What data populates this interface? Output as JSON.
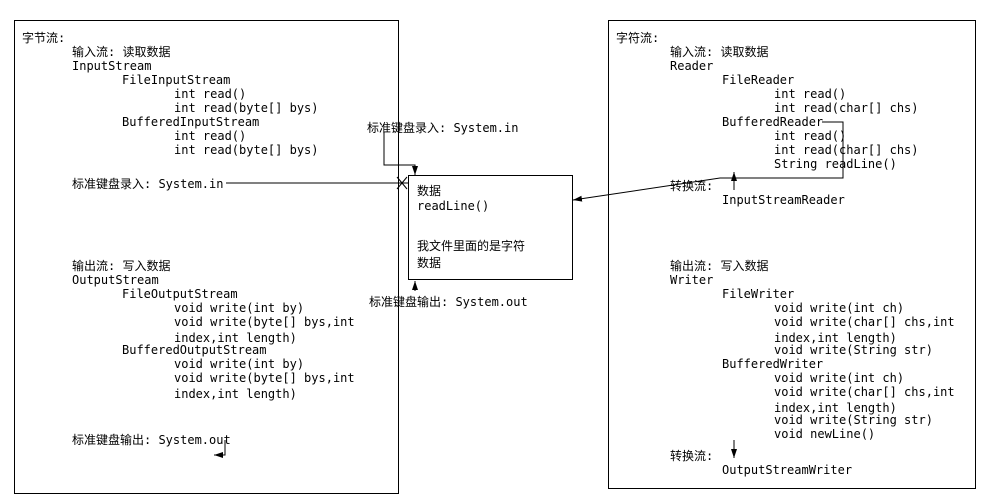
{
  "left": {
    "title": "字节流:",
    "in_header": "输入流: 读取数据",
    "InputStream": "InputStream",
    "FileInputStream": "FileInputStream",
    "fis_read1": "int read()",
    "fis_read2": "int read(byte[] bys)",
    "BufferedInputStream": "BufferedInputStream",
    "bis_read1": "int read()",
    "bis_read2": "int read(byte[] bys)",
    "stdin_label": "标准键盘录入: System.in",
    "out_header": "输出流: 写入数据",
    "OutputStream": "OutputStream",
    "FileOutputStream": "FileOutputStream",
    "fos_w1": "void write(int by)",
    "fos_w2": "void write(byte[] bys,int\nindex,int length)",
    "BufferedOutputStream": "BufferedOutputStream",
    "bos_w1": "void write(int by)",
    "bos_w2": "void write(byte[] bys,int\nindex,int length)",
    "stdout_label": "标准键盘输出: System.out"
  },
  "center": {
    "kb_in": "标准键盘录入: System.in",
    "data1": "数据",
    "readline": "readLine()",
    "data2": "我文件里面的是字符\n数据",
    "kb_out": "标准键盘输出: System.out"
  },
  "right": {
    "title": "字符流:",
    "in_header": "输入流: 读取数据",
    "Reader": "Reader",
    "FileReader": "FileReader",
    "fr_r1": "int read()",
    "fr_r2": "int read(char[] chs)",
    "BufferedReader": "BufferedReader",
    "br_r1": "int read()",
    "br_r2": "int read(char[] chs)",
    "br_r3": "String readLine()",
    "conv_in_label": "转换流:",
    "InputStreamReader": "InputStreamReader",
    "out_header": "输出流: 写入数据",
    "Writer": "Writer",
    "FileWriter": "FileWriter",
    "fw_w1": "void write(int ch)",
    "fw_w2": "void write(char[] chs,int\nindex,int length)",
    "fw_w3": "void write(String str)",
    "BufferedWriter": "BufferedWriter",
    "bw_w1": "void write(int ch)",
    "bw_w2": "void write(char[] chs,int\nindex,int length)",
    "bw_w3": "void write(String str)",
    "bw_w4": "void newLine()",
    "conv_out_label": "转换流:",
    "OutputStreamWriter": "OutputStreamWriter"
  }
}
